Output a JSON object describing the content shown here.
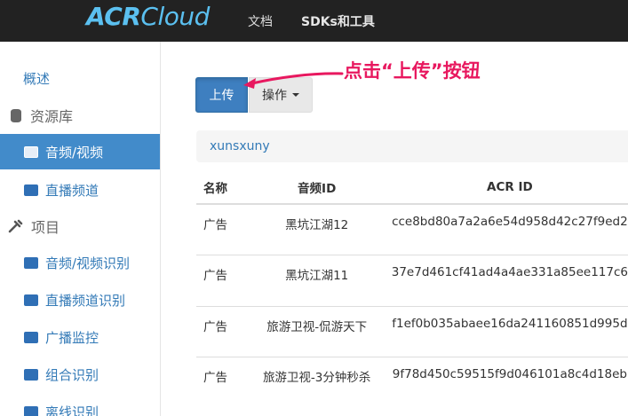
{
  "navbar": {
    "logo_part1": "ACR",
    "logo_part2": "Cloud",
    "links": [
      "文档",
      "SDKs和工具"
    ]
  },
  "sidebar": {
    "items": [
      {
        "label": "概述",
        "icon": "none"
      },
      {
        "label": "资源库",
        "icon": "database-icon"
      },
      {
        "label": "音频/视频",
        "icon": "audio-video-icon"
      },
      {
        "label": "直播频道",
        "icon": "live-channel-icon"
      },
      {
        "label": "项目",
        "icon": "wrench-icon"
      },
      {
        "label": "音频/视频识别",
        "icon": "audio-video-recognition-icon"
      },
      {
        "label": "直播频道识别",
        "icon": "live-channel-recognition-icon"
      },
      {
        "label": "广播监控",
        "icon": "broadcast-monitor-icon"
      },
      {
        "label": "组合识别",
        "icon": "combined-recognition-icon"
      },
      {
        "label": "离线识别",
        "icon": "offline-recognition-icon"
      }
    ]
  },
  "toolbar": {
    "upload_label": "上传",
    "ops_label": "操作"
  },
  "annotation": {
    "text": "点击“上传”按钮",
    "color": "#e8185f"
  },
  "bucket": {
    "name": "xunsxuny"
  },
  "table": {
    "headers": [
      "名称",
      "音频ID",
      "ACR ID"
    ],
    "rows": [
      {
        "name": "广告",
        "audio_id": "黑坑江湖12",
        "acr_id": "cce8bd80a7a2a6e54d958d42c27f9ed2"
      },
      {
        "name": "广告",
        "audio_id": "黑坑江湖11",
        "acr_id": "37e7d461cf41ad4a4ae331a85ee117c6"
      },
      {
        "name": "广告",
        "audio_id": "旅游卫视-侃游天下",
        "acr_id": "f1ef0b035abaee16da241160851d995d"
      },
      {
        "name": "广告",
        "audio_id": "旅游卫视-3分钟秒杀",
        "acr_id": "9f78d450c59515f9d046101a8c4d18eb"
      }
    ]
  },
  "colors": {
    "navbar_bg": "#222222",
    "logo": "#5bc0f0",
    "active": "#428bca",
    "link": "#337ab7"
  }
}
